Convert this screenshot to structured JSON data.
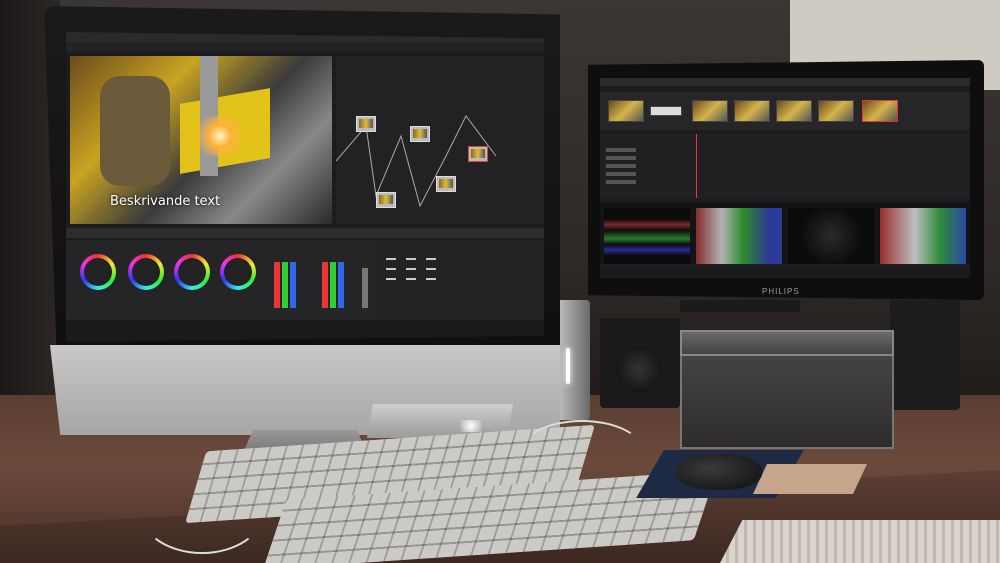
{
  "main_screen": {
    "video_caption": "Beskrivande text",
    "brand_logo": "apple-logo"
  },
  "secondary_screen": {
    "brand_label": "PHILIPS"
  }
}
